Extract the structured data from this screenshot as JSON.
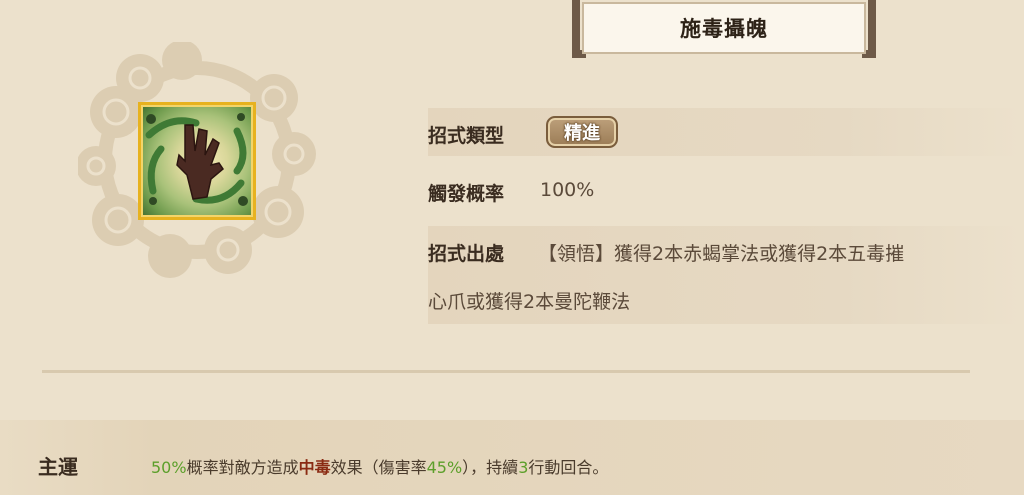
{
  "skill": {
    "title": "施毒攝魄",
    "icon": "poison-hand-icon"
  },
  "details": {
    "type_label": "招式類型",
    "type_badge": "精進",
    "rate_label": "觸發概率",
    "rate_value": "100%",
    "source_label": "招式出處",
    "source_line1": "【領悟】獲得2本赤蝎掌法或獲得2本五毒摧",
    "source_line2": "心爪或獲得2本曼陀鞭法"
  },
  "effect": {
    "label": "主運",
    "part1": "50%",
    "part2": "概率對敵方造成",
    "part3": "中毒",
    "part4": "效果（傷害率",
    "part5": "45%",
    "part6": "），持續",
    "part7": "3",
    "part8": "行動回合。"
  },
  "colors": {
    "background": "#ece1cc",
    "highlight_green": "#5c9f2a",
    "highlight_red": "#8a2a12",
    "icon_border": "#e7b21f"
  }
}
